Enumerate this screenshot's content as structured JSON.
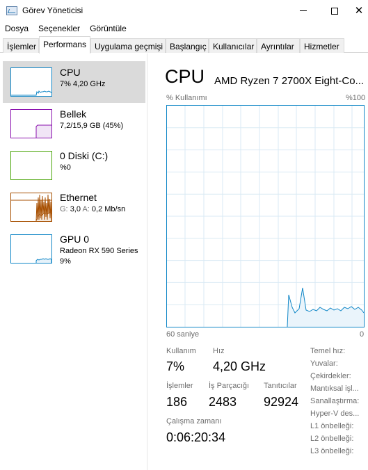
{
  "window": {
    "title": "Görev Yöneticisi",
    "close_glyph": "✕"
  },
  "menu": [
    "Dosya",
    "Seçenekler",
    "Görüntüle"
  ],
  "tabs": [
    "İşlemler",
    "Performans",
    "Uygulama geçmişi",
    "Başlangıç",
    "Kullanıcılar",
    "Ayrıntılar",
    "Hizmetler"
  ],
  "active_tab": "Performans",
  "sidebar": {
    "items": [
      {
        "title": "CPU",
        "sub": "7% 4,20 GHz",
        "color": "#1187c7",
        "selected": true
      },
      {
        "title": "Bellek",
        "sub": "7,2/15,9 GB (45%)",
        "color": "#8b12ae"
      },
      {
        "title": "0 Diski (C:)",
        "sub": "%0",
        "color": "#4da60c"
      },
      {
        "title": "Ethernet",
        "sub_g_label": "G:",
        "sub_g_value": "3,0",
        "sub_a_label": "A:",
        "sub_a_value": "0,2 Mb/sn",
        "color": "#a74f01"
      },
      {
        "title": "GPU 0",
        "sub": "Radeon RX 590 Series",
        "sub2": "9%",
        "color": "#1187c7"
      }
    ]
  },
  "main": {
    "title": "CPU",
    "model": "AMD Ryzen 7 2700X Eight-Co...",
    "graph": {
      "y_label": "% Kullanımı",
      "y_max_label": "%100",
      "x_label": "60 saniye",
      "x_end_label": "0",
      "color": "#1187c7"
    },
    "stats": {
      "utilization_label": "Kullanım",
      "utilization_value": "7%",
      "speed_label": "Hız",
      "speed_value": "4,20 GHz",
      "processes_label": "İşlemler",
      "processes_value": "186",
      "threads_label": "İş Parçacığı",
      "threads_value": "2483",
      "handles_label": "Tanıtıcılar",
      "handles_value": "92924",
      "uptime_label": "Çalışma zamanı",
      "uptime_value": "0:06:20:34"
    },
    "specs": [
      "Temel hız:",
      "Yuvalar:",
      "Çekirdekler:",
      "Mantıksal işl...",
      "Sanallaştırma:",
      "Hyper-V des...",
      "L1 önbelleği:",
      "L2 önbelleği:",
      "L3 önbelleği:"
    ]
  }
}
